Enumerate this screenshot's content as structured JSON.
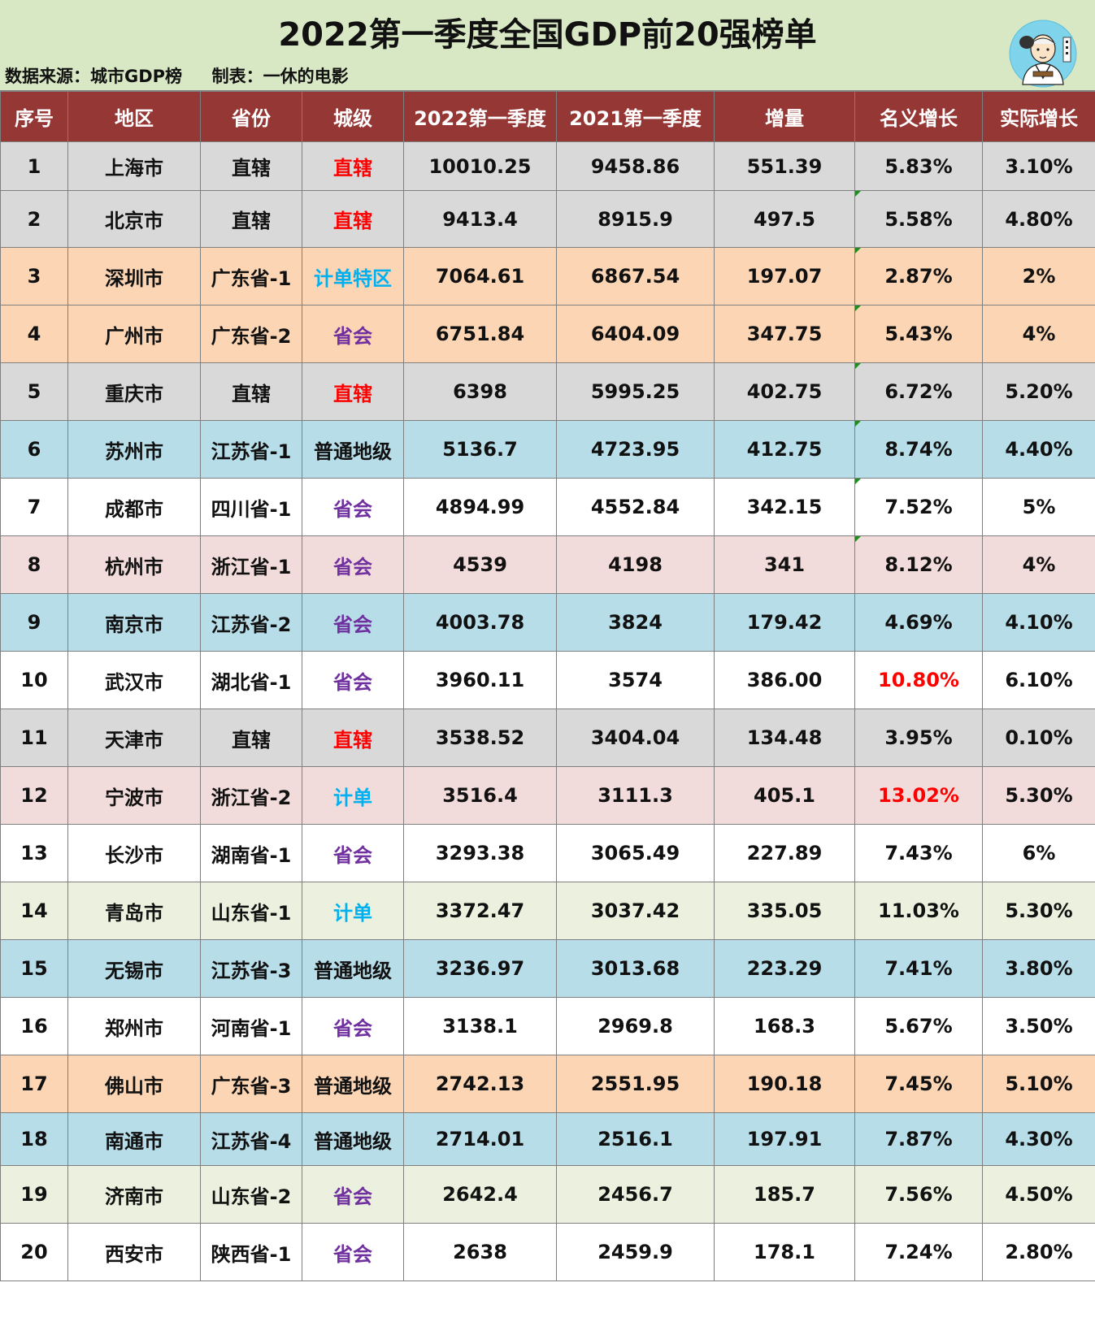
{
  "title": "2022第一季度全国GDP前20强榜单",
  "source_line": "数据来源：城市GDP榜     制表：一休的电影",
  "colors": {
    "header_band": "#d9e8c4",
    "table_header": "#953735",
    "gray_row": "#d9d9d9",
    "orange_row": "#fcd5b4",
    "blue_row": "#b7dde8",
    "pink_row": "#f2dcdb",
    "green_row": "#ebf1de",
    "white_row": "#ffffff",
    "tier_direct": "#ff0000",
    "tier_capital": "#7030a0",
    "tier_plan": "#00b0f0",
    "tier_normal": "#111111",
    "highlight_red": "#ff0000"
  },
  "columns": [
    "序号",
    "地区",
    "省份",
    "城级",
    "2022第一季度",
    "2021第一季度",
    "增量",
    "名义增长",
    "实际增长"
  ],
  "rows": [
    {
      "rank": "1",
      "city": "上海市",
      "province": "直辖",
      "tier": "直辖",
      "tier_color": "#ff0000",
      "gdp2022": "10010.25",
      "gdp2021": "9458.86",
      "increase": "551.39",
      "nominal": "5.83%",
      "nominal_color": "#111111",
      "real": "3.10%",
      "bg": "#d9d9d9",
      "flag": false
    },
    {
      "rank": "2",
      "city": "北京市",
      "province": "直辖",
      "tier": "直辖",
      "tier_color": "#ff0000",
      "gdp2022": "9413.4",
      "gdp2021": "8915.9",
      "increase": "497.5",
      "nominal": "5.58%",
      "nominal_color": "#111111",
      "real": "4.80%",
      "bg": "#d9d9d9",
      "flag": true
    },
    {
      "rank": "3",
      "city": "深圳市",
      "province": "广东省-1",
      "tier": "计单特区",
      "tier_color": "#00b0f0",
      "gdp2022": "7064.61",
      "gdp2021": "6867.54",
      "increase": "197.07",
      "nominal": "2.87%",
      "nominal_color": "#111111",
      "real": "2%",
      "bg": "#fcd5b4",
      "flag": true
    },
    {
      "rank": "4",
      "city": "广州市",
      "province": "广东省-2",
      "tier": "省会",
      "tier_color": "#7030a0",
      "gdp2022": "6751.84",
      "gdp2021": "6404.09",
      "increase": "347.75",
      "nominal": "5.43%",
      "nominal_color": "#111111",
      "real": "4%",
      "bg": "#fcd5b4",
      "flag": true
    },
    {
      "rank": "5",
      "city": "重庆市",
      "province": "直辖",
      "tier": "直辖",
      "tier_color": "#ff0000",
      "gdp2022": "6398",
      "gdp2021": "5995.25",
      "increase": "402.75",
      "nominal": "6.72%",
      "nominal_color": "#111111",
      "real": "5.20%",
      "bg": "#d9d9d9",
      "flag": true
    },
    {
      "rank": "6",
      "city": "苏州市",
      "province": "江苏省-1",
      "tier": "普通地级",
      "tier_color": "#111111",
      "gdp2022": "5136.7",
      "gdp2021": "4723.95",
      "increase": "412.75",
      "nominal": "8.74%",
      "nominal_color": "#111111",
      "real": "4.40%",
      "bg": "#b7dde8",
      "flag": true
    },
    {
      "rank": "7",
      "city": "成都市",
      "province": "四川省-1",
      "tier": "省会",
      "tier_color": "#7030a0",
      "gdp2022": "4894.99",
      "gdp2021": "4552.84",
      "increase": "342.15",
      "nominal": "7.52%",
      "nominal_color": "#111111",
      "real": "5%",
      "bg": "#ffffff",
      "flag": true
    },
    {
      "rank": "8",
      "city": "杭州市",
      "province": "浙江省-1",
      "tier": "省会",
      "tier_color": "#7030a0",
      "gdp2022": "4539",
      "gdp2021": "4198",
      "increase": "341",
      "nominal": "8.12%",
      "nominal_color": "#111111",
      "real": "4%",
      "bg": "#f2dcdb",
      "flag": true
    },
    {
      "rank": "9",
      "city": "南京市",
      "province": "江苏省-2",
      "tier": "省会",
      "tier_color": "#7030a0",
      "gdp2022": "4003.78",
      "gdp2021": "3824",
      "increase": "179.42",
      "nominal": "4.69%",
      "nominal_color": "#111111",
      "real": "4.10%",
      "bg": "#b7dde8",
      "flag": false
    },
    {
      "rank": "10",
      "city": "武汉市",
      "province": "湖北省-1",
      "tier": "省会",
      "tier_color": "#7030a0",
      "gdp2022": "3960.11",
      "gdp2021": "3574",
      "increase": "386.00",
      "nominal": "10.80%",
      "nominal_color": "#ff0000",
      "real": "6.10%",
      "bg": "#ffffff",
      "flag": false
    },
    {
      "rank": "11",
      "city": "天津市",
      "province": "直辖",
      "tier": "直辖",
      "tier_color": "#ff0000",
      "gdp2022": "3538.52",
      "gdp2021": "3404.04",
      "increase": "134.48",
      "nominal": "3.95%",
      "nominal_color": "#111111",
      "real": "0.10%",
      "bg": "#d9d9d9",
      "flag": false
    },
    {
      "rank": "12",
      "city": "宁波市",
      "province": "浙江省-2",
      "tier": "计单",
      "tier_color": "#00b0f0",
      "gdp2022": "3516.4",
      "gdp2021": "3111.3",
      "increase": "405.1",
      "nominal": "13.02%",
      "nominal_color": "#ff0000",
      "real": "5.30%",
      "bg": "#f2dcdb",
      "flag": false
    },
    {
      "rank": "13",
      "city": "长沙市",
      "province": "湖南省-1",
      "tier": "省会",
      "tier_color": "#7030a0",
      "gdp2022": "3293.38",
      "gdp2021": "3065.49",
      "increase": "227.89",
      "nominal": "7.43%",
      "nominal_color": "#111111",
      "real": "6%",
      "bg": "#ffffff",
      "flag": false
    },
    {
      "rank": "14",
      "city": "青岛市",
      "province": "山东省-1",
      "tier": "计单",
      "tier_color": "#00b0f0",
      "gdp2022": "3372.47",
      "gdp2021": "3037.42",
      "increase": "335.05",
      "nominal": "11.03%",
      "nominal_color": "#111111",
      "real": "5.30%",
      "bg": "#ebf1de",
      "flag": false
    },
    {
      "rank": "15",
      "city": "无锡市",
      "province": "江苏省-3",
      "tier": "普通地级",
      "tier_color": "#111111",
      "gdp2022": "3236.97",
      "gdp2021": "3013.68",
      "increase": "223.29",
      "nominal": "7.41%",
      "nominal_color": "#111111",
      "real": "3.80%",
      "bg": "#b7dde8",
      "flag": false
    },
    {
      "rank": "16",
      "city": "郑州市",
      "province": "河南省-1",
      "tier": "省会",
      "tier_color": "#7030a0",
      "gdp2022": "3138.1",
      "gdp2021": "2969.8",
      "increase": "168.3",
      "nominal": "5.67%",
      "nominal_color": "#111111",
      "real": "3.50%",
      "bg": "#ffffff",
      "flag": false
    },
    {
      "rank": "17",
      "city": "佛山市",
      "province": "广东省-3",
      "tier": "普通地级",
      "tier_color": "#111111",
      "gdp2022": "2742.13",
      "gdp2021": "2551.95",
      "increase": "190.18",
      "nominal": "7.45%",
      "nominal_color": "#111111",
      "real": "5.10%",
      "bg": "#fcd5b4",
      "flag": false
    },
    {
      "rank": "18",
      "city": "南通市",
      "province": "江苏省-4",
      "tier": "普通地级",
      "tier_color": "#111111",
      "gdp2022": "2714.01",
      "gdp2021": "2516.1",
      "increase": "197.91",
      "nominal": "7.87%",
      "nominal_color": "#111111",
      "real": "4.30%",
      "bg": "#b7dde8",
      "flag": false
    },
    {
      "rank": "19",
      "city": "济南市",
      "province": "山东省-2",
      "tier": "省会",
      "tier_color": "#7030a0",
      "gdp2022": "2642.4",
      "gdp2021": "2456.7",
      "increase": "185.7",
      "nominal": "7.56%",
      "nominal_color": "#111111",
      "real": "4.50%",
      "bg": "#ebf1de",
      "flag": false
    },
    {
      "rank": "20",
      "city": "西安市",
      "province": "陕西省-1",
      "tier": "省会",
      "tier_color": "#7030a0",
      "gdp2022": "2638",
      "gdp2021": "2459.9",
      "increase": "178.1",
      "nominal": "7.24%",
      "nominal_color": "#111111",
      "real": "2.80%",
      "bg": "#ffffff",
      "flag": false
    }
  ]
}
